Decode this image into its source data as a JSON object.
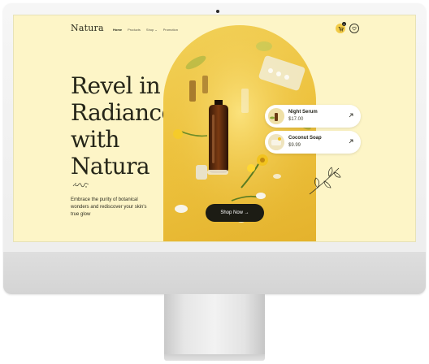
{
  "site": {
    "logo": "Natura"
  },
  "nav": {
    "items": [
      "Home",
      "Products",
      "Shop",
      "Promotion"
    ],
    "active": "Home",
    "shop_has_dropdown": true
  },
  "header": {
    "cart_count": "0",
    "cart_icon": "cart-icon",
    "wishlist_icon": "heart-icon"
  },
  "hero": {
    "headline_lines": [
      "Revel in",
      "Radiance",
      "with Natura"
    ],
    "body": "Embrace the purity of botanical wonders and rediscover your skin's true glow",
    "cta_label": "Shop Now →"
  },
  "products": [
    {
      "name": "Night Serum",
      "price": "$17.00"
    },
    {
      "name": "Coconut Soap",
      "price": "$9.99"
    }
  ],
  "colors": {
    "background": "#fdf5c7",
    "accent": "#f2cb46",
    "cta": "#1c1c14",
    "text": "#262619"
  }
}
